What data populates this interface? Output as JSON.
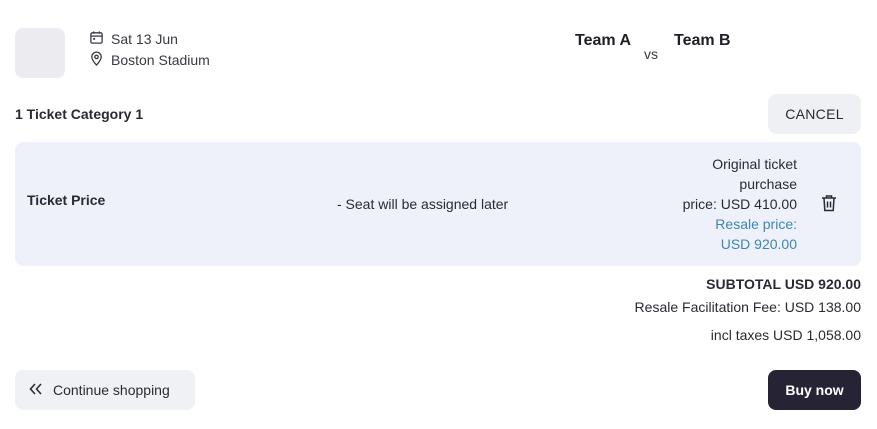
{
  "event": {
    "date": "Sat 13 Jun",
    "venue": "Boston Stadium",
    "home_team": "Team A",
    "vs": "vs",
    "away_team": "Team B"
  },
  "category_title": "1 Ticket Category 1",
  "cancel_label": "CANCEL",
  "ticket": {
    "label": "Ticket Price",
    "seat_note": "- Seat will be assigned later",
    "original_line1": "Original ticket",
    "original_line2": "purchase",
    "original_line3": "price: USD 410.00",
    "resale_line1": "Resale price:",
    "resale_line2": "USD 920.00"
  },
  "summary": {
    "subtotal": "SUBTOTAL USD 920.00",
    "fee": "Resale Facilitation Fee: USD 138.00",
    "total": "incl taxes USD 1,058.00"
  },
  "continue_label": "Continue shopping",
  "buy_label": "Buy now",
  "colors": {
    "accent_dark": "#262335",
    "resale_blue": "#3d86b5",
    "card_bg": "#eef1fa"
  }
}
